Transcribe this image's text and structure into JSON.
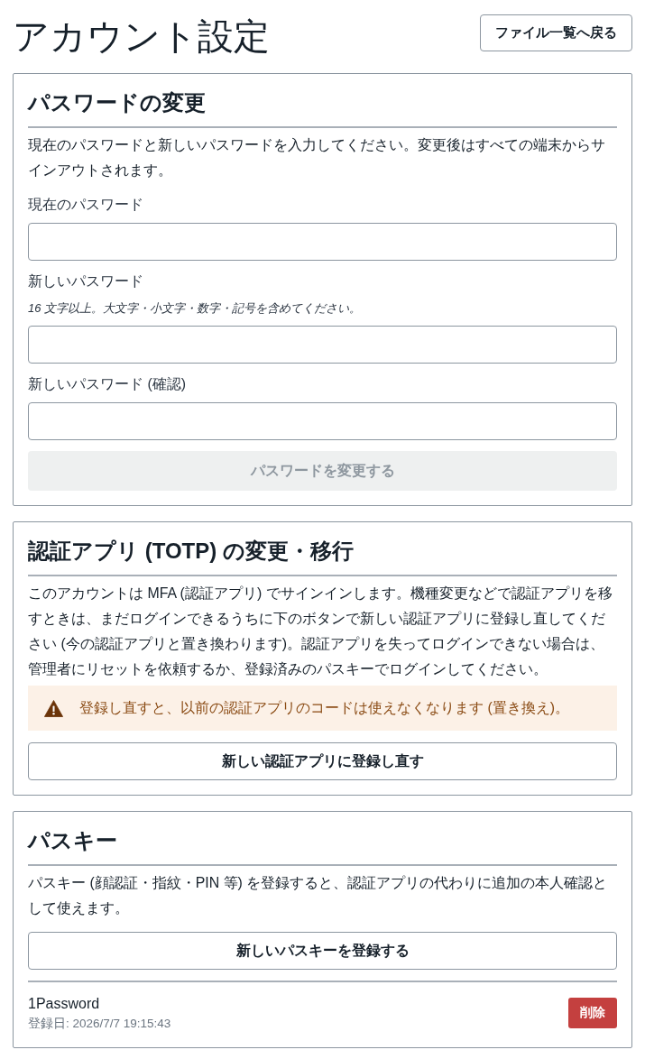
{
  "header": {
    "title": "アカウント設定",
    "back_button": "ファイル一覧へ戻る"
  },
  "password_change": {
    "heading": "パスワードの変更",
    "description": "現在のパスワードと新しいパスワードを入力してください。変更後はすべての端末からサインアウトされます。",
    "fields": [
      {
        "label": "現在のパスワード"
      },
      {
        "label": "新しいパスワード",
        "hint": "16 文字以上。大文字・小文字・数字・記号を含めてください。"
      },
      {
        "label": "新しいパスワード (確認)"
      }
    ],
    "submit_button": {
      "label": "パスワードを変更する",
      "disabled": true
    }
  },
  "totp": {
    "heading": "認証アプリ (TOTP) の変更・移行",
    "description": "このアカウントは MFA (認証アプリ) でサインインします。機種変更などで認証アプリを移すときは、まだログインできるうちに下のボタンで新しい認証アプリに登録し直してください (今の認証アプリと置き換わります)。認証アプリを失ってログインできない場合は、管理者にリセットを依頼するか、登録済みのパスキーでログインしてください。",
    "warning": "登録し直すと、以前の認証アプリのコードは使えなくなります (置き換え)。",
    "reregister_button": "新しい認証アプリに登録し直す"
  },
  "passkeys": {
    "heading": "パスキー",
    "description": "パスキー (顔認証・指紋・PIN 等) を登録すると、認証アプリの代わりに追加の本人確認として使えます。",
    "register_button": "新しいパスキーを登録する",
    "items": [
      {
        "name": "1Password",
        "registered": "登録日: 2026/7/7 19:15:43",
        "delete_button": "削除"
      }
    ]
  }
}
